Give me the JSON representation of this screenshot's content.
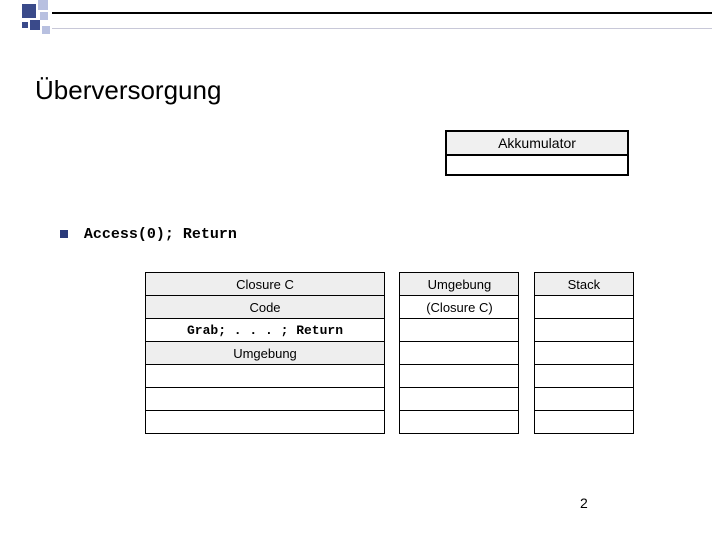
{
  "slide": {
    "title": "Überversorgung",
    "page_number": "2"
  },
  "accumulator": {
    "label": "Akkumulator"
  },
  "instruction": {
    "text": "Access(0); Return"
  },
  "left_table": {
    "r1": "Closure C",
    "r2": "Code",
    "r3": "Grab; . . . ; Return",
    "r4": "Umgebung"
  },
  "mid_table": {
    "r1": "Umgebung",
    "r2": "(Closure C)"
  },
  "right_table": {
    "r1": "Stack"
  }
}
